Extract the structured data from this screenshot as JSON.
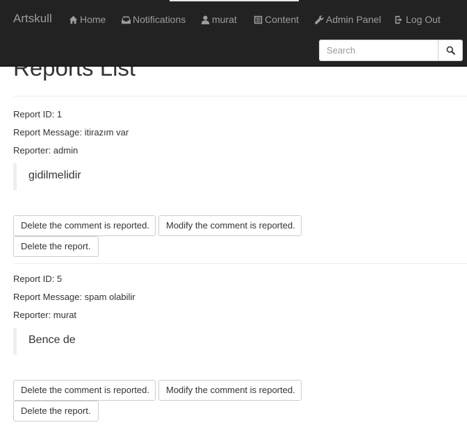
{
  "navbar": {
    "brand": "Artskull",
    "items": [
      {
        "label": "Home",
        "icon": "home-icon"
      },
      {
        "label": "Notifications",
        "icon": "inbox-icon"
      },
      {
        "label": "murat",
        "icon": "user-icon"
      },
      {
        "label": "Content",
        "icon": "list-icon"
      },
      {
        "label": "Admin Panel",
        "icon": "wrench-icon"
      },
      {
        "label": "Log Out",
        "icon": "logout-icon"
      }
    ],
    "search": {
      "placeholder": "Search",
      "value": ""
    }
  },
  "page": {
    "title": "Reports List"
  },
  "reports": [
    {
      "id_label": "Report ID: 1",
      "message_label": "Report Message: itirazım var",
      "reporter_label": "Reporter: admin",
      "comment": "gidilmelidir",
      "buttons": {
        "delete_comment": "Delete the comment is reported.",
        "modify_comment": "Modify the comment is reported.",
        "delete_report": "Delete the report."
      }
    },
    {
      "id_label": "Report ID: 5",
      "message_label": "Report Message: spam olabilir",
      "reporter_label": "Reporter: murat",
      "comment": "Bence de",
      "buttons": {
        "delete_comment": "Delete the comment is reported.",
        "modify_comment": "Modify the comment is reported.",
        "delete_report": "Delete the report."
      }
    }
  ],
  "colors": {
    "navbar_bg": "#222222",
    "nav_text": "#9d9d9d",
    "text": "#333333",
    "rule": "#eeeeee"
  }
}
